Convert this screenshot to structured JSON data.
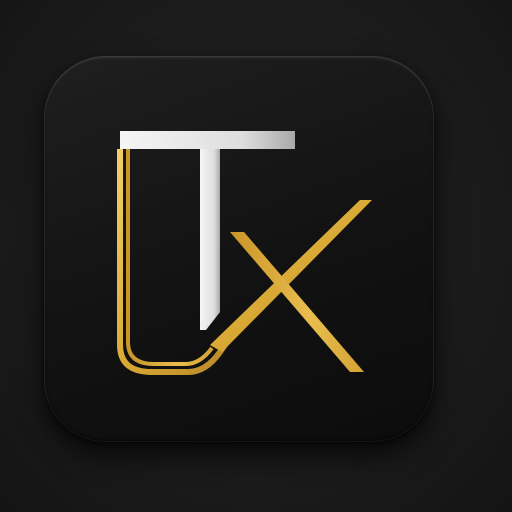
{
  "logo": {
    "description_icon": "monogram-logo-icon",
    "letters": "UTx",
    "colors": {
      "background": "#1b1b1b",
      "icon_tile": "#121212",
      "gold": "#d9a935",
      "gold_light": "#f2cf6a",
      "silver": "#e8e8e8",
      "silver_shadow": "#a9a9a9"
    }
  }
}
